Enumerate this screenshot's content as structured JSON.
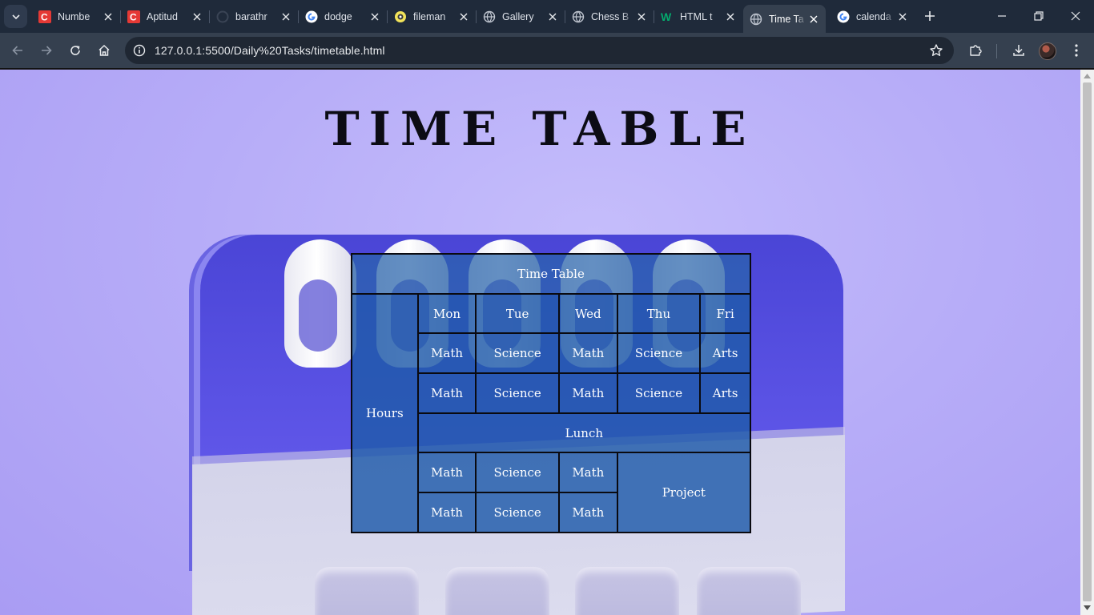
{
  "browser": {
    "tabs": [
      {
        "title": "Numbe",
        "favicon": "c-red-icon",
        "active": false
      },
      {
        "title": "Aptitud",
        "favicon": "c-red-icon",
        "active": false
      },
      {
        "title": "barathr",
        "favicon": "github-icon",
        "active": false
      },
      {
        "title": "dodge",
        "favicon": "google-icon",
        "active": false
      },
      {
        "title": "fileman",
        "favicon": "yellow-app-icon",
        "active": false
      },
      {
        "title": "Gallery",
        "favicon": "globe-icon",
        "active": false
      },
      {
        "title": "Chess B",
        "favicon": "globe-icon",
        "active": false
      },
      {
        "title": "HTML t",
        "favicon": "w3-icon",
        "active": false
      },
      {
        "title": "Time Ta",
        "favicon": "globe-icon",
        "active": true
      },
      {
        "title": "calenda",
        "favicon": "google-icon",
        "active": false
      }
    ],
    "address": "127.0.0.1:5500/Daily%20Tasks/timetable.html"
  },
  "page": {
    "heading": "TIME TABLE",
    "table": {
      "caption": "Time Table",
      "hours_label": "Hours",
      "days": [
        "Mon",
        "Tue",
        "Wed",
        "Thu",
        "Fri"
      ],
      "row1": [
        "Math",
        "Science",
        "Math",
        "Science",
        "Arts"
      ],
      "row2": [
        "Math",
        "Science",
        "Math",
        "Science",
        "Arts"
      ],
      "lunch": "Lunch",
      "row3": [
        "Math",
        "Science",
        "Math"
      ],
      "row4": [
        "Math",
        "Science",
        "Math"
      ],
      "project": "Project"
    }
  },
  "colors": {
    "background": "#b7adf8",
    "table_cell": "#1f5aaa",
    "tab_strip": "#1f2a3a",
    "toolbar": "#35404f"
  }
}
